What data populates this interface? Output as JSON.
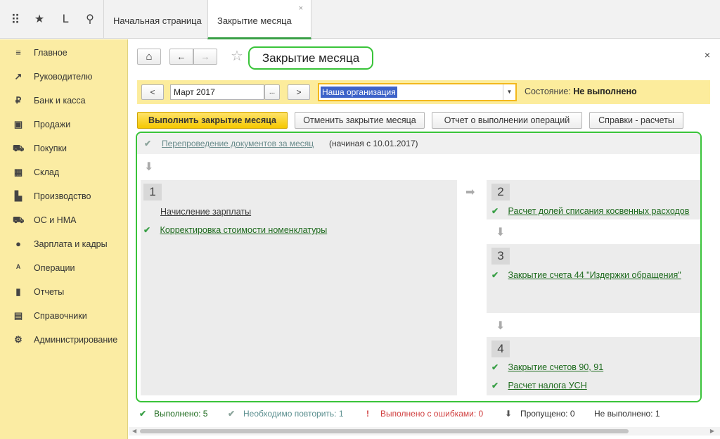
{
  "topbar": {
    "tools": [
      {
        "name": "apps-grid-icon",
        "glyph": "⠿"
      },
      {
        "name": "favorites-star-icon",
        "glyph": "★"
      },
      {
        "name": "history-icon",
        "glyph": "ᒪ"
      },
      {
        "name": "search-icon",
        "glyph": "⚲"
      }
    ],
    "tabs": [
      {
        "label": "Начальная страница",
        "active": false
      },
      {
        "label": "Закрытие месяца",
        "active": true,
        "close": "×"
      }
    ]
  },
  "sidebar": {
    "items": [
      {
        "label": "Главное",
        "icon": "menu-lines-icon",
        "glyph": "≡"
      },
      {
        "label": "Руководителю",
        "icon": "trend-icon",
        "glyph": "↗"
      },
      {
        "label": "Банк и касса",
        "icon": "ruble-coin-icon",
        "glyph": "₽"
      },
      {
        "label": "Продажи",
        "icon": "shopping-bag-icon",
        "glyph": "▣"
      },
      {
        "label": "Покупки",
        "icon": "cart-icon",
        "glyph": "⛟"
      },
      {
        "label": "Склад",
        "icon": "warehouse-icon",
        "glyph": "▦"
      },
      {
        "label": "Производство",
        "icon": "factory-icon",
        "glyph": "▙"
      },
      {
        "label": "ОС и НМА",
        "icon": "truck-icon",
        "glyph": "⛟"
      },
      {
        "label": "Зарплата и кадры",
        "icon": "person-icon",
        "glyph": "●"
      },
      {
        "label": "Операции",
        "icon": "operations-icon",
        "glyph": "ᴬ"
      },
      {
        "label": "Отчеты",
        "icon": "bar-chart-icon",
        "glyph": "▮"
      },
      {
        "label": "Справочники",
        "icon": "book-icon",
        "glyph": "▤"
      },
      {
        "label": "Администрирование",
        "icon": "gear-icon",
        "glyph": "⚙"
      }
    ]
  },
  "header": {
    "home_glyph": "⌂",
    "back_glyph": "←",
    "forward_glyph": "→",
    "star_glyph": "☆",
    "title": "Закрытие месяца",
    "close_glyph": "×"
  },
  "filter": {
    "prev_label": "<",
    "period_value": "Март 2017",
    "period_picker_label": "...",
    "next_label": ">",
    "organization_value": "Наша организация",
    "dropdown_glyph": "▼",
    "state_label": "Состояние:",
    "state_value": "Не выполнено"
  },
  "actions": {
    "execute": "Выполнить закрытие месяца",
    "cancel": "Отменить закрытие месяца",
    "report": "Отчет о выполнении операций",
    "calculations": "Справки - расчеты"
  },
  "panel": {
    "repost": {
      "check": "✔",
      "link": "Перепроведение документов за месяц",
      "note": "(начиная с 10.01.2017)"
    },
    "down_arrow": "⬇",
    "right_arrow": "➡",
    "group1": {
      "number": "1",
      "items": [
        {
          "check": "",
          "label": "Начисление зарплаты"
        },
        {
          "check": "✔",
          "label": "Корректировка стоимости номенклатуры"
        }
      ]
    },
    "group2": {
      "number": "2",
      "items": [
        {
          "check": "✔",
          "label": "Расчет долей списания косвенных расходов"
        }
      ]
    },
    "group3": {
      "number": "3",
      "items": [
        {
          "check": "✔",
          "label": "Закрытие счета 44 \"Издержки обращения\""
        }
      ]
    },
    "group4": {
      "number": "4",
      "items": [
        {
          "check": "✔",
          "label": "Закрытие счетов 90, 91"
        },
        {
          "check": "✔",
          "label": "Расчет налога УСН"
        }
      ]
    }
  },
  "status": {
    "done": "Выполнено: 5",
    "repeat": "Необходимо повторить: 1",
    "errors": "Выполнено с ошибками: 0",
    "skipped": "Пропущено: 0",
    "not_done": "Не выполнено: 1",
    "check_glyph": "✔",
    "error_glyph": "!",
    "skip_glyph": "⬇",
    "colors": {
      "done": "#1d6a1d",
      "repeat": "#5b8f8f",
      "errors": "#d04040",
      "skipped": "#333333",
      "not_done": "#333333"
    }
  },
  "scrollbar": {
    "left_glyph": "◀",
    "right_glyph": "▶"
  }
}
